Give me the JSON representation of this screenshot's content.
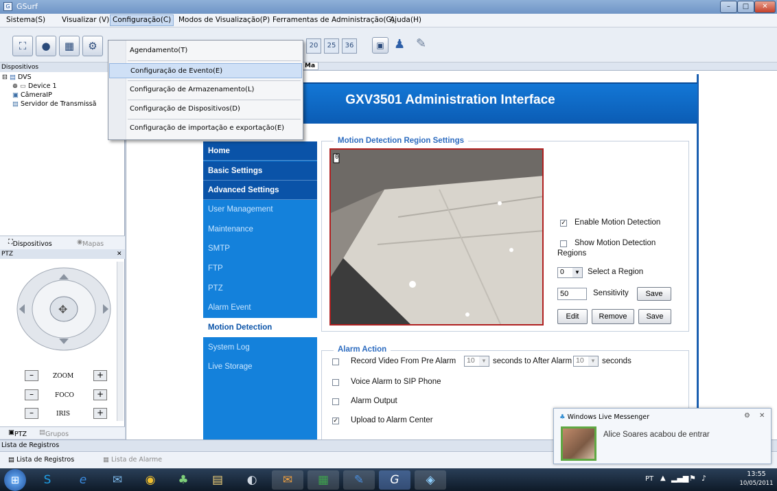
{
  "window": {
    "title": "GSurf"
  },
  "menu": [
    "Sistema(S)",
    "Visualizar (V)",
    "Configuração(C)",
    "Modos de Visualização(P)",
    "Ferramentas de Administração(G)",
    "Ajuda(H)"
  ],
  "toolbar": {
    "nums": [
      "20",
      "25",
      "36"
    ]
  },
  "dropdown": {
    "items": [
      "Agendamento(T)",
      "Configuração de Evento(E)",
      "Configuração de Armazenamento(L)",
      "Configuração de Dispositivos(D)",
      "Configuração de importação e exportação(E)"
    ]
  },
  "left": {
    "panel_title": "Dispositivos",
    "tree": [
      "DVS",
      "Device 1",
      "CâmeraIP",
      "Servidor de Transmissã"
    ],
    "tabs": [
      "Dispositivos",
      "Mapas"
    ],
    "ptz_title": "PTZ",
    "ptz_rows": [
      "ZOOM",
      "FOCO",
      "IRIS"
    ],
    "bottom_tabs": [
      "PTZ",
      "Grupos"
    ]
  },
  "web": {
    "tab_fragment": "Ma",
    "title": "GXV3501 Administration Interface",
    "nav": [
      {
        "label": "Home",
        "style": "dark"
      },
      {
        "label": "Basic Settings",
        "style": "dark"
      },
      {
        "label": "Advanced Settings",
        "style": "dark"
      },
      {
        "label": "User Management",
        "style": "light"
      },
      {
        "label": "Maintenance",
        "style": "light"
      },
      {
        "label": "SMTP",
        "style": "light"
      },
      {
        "label": "FTP",
        "style": "light"
      },
      {
        "label": "PTZ",
        "style": "light"
      },
      {
        "label": "Alarm Event",
        "style": "light"
      },
      {
        "label": "Motion Detection",
        "style": "active"
      },
      {
        "label": "System Log",
        "style": "light"
      },
      {
        "label": "Live Storage",
        "style": "light"
      }
    ],
    "motion": {
      "section": "Motion Detection Region Settings",
      "overlay_digit": "0",
      "enable_label": "Enable Motion Detection",
      "show_label": "Show Motion Detection",
      "show_label2": "Regions",
      "region_value": "0",
      "region_label": "Select a Region",
      "sensitivity_value": "50",
      "sensitivity_label": "Sensitivity",
      "save": "Save",
      "edit": "Edit",
      "remove": "Remove"
    },
    "alarm": {
      "section": "Alarm Action",
      "record_pre": "Record Video From Pre Alarm",
      "pre_value": "10",
      "seconds_to": "seconds  to After Alarm",
      "after_value": "10",
      "seconds": "seconds",
      "voice": "Voice Alarm to SIP Phone",
      "output": "Alarm Output",
      "upload": "Upload to Alarm Center"
    }
  },
  "bottom": {
    "panel_title": "Lista de Registros",
    "tabs": [
      "Lista de Registros",
      "Lista de Alarme"
    ]
  },
  "notification": {
    "app": "Windows Live Messenger",
    "message": "Alice Soares acabou de entrar"
  },
  "tray": {
    "lang": "PT",
    "time": "13:55",
    "date": "10/05/2011"
  }
}
